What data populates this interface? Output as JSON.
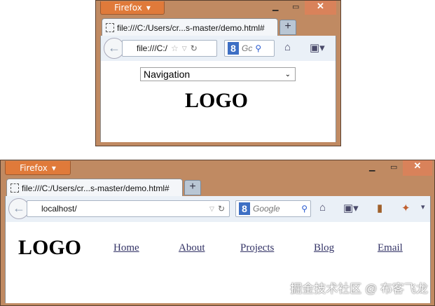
{
  "mobile_window": {
    "app_button": "Firefox",
    "tab_title": "file:///C:/Users/cr...s-master/demo.html#",
    "url": "file:///C:/",
    "search_placeholder": "Gc",
    "select_value": "Navigation",
    "logo": "LOGO"
  },
  "desktop_window": {
    "app_button": "Firefox",
    "tab_title": "file:///C:/Users/cr...s-master/demo.html#",
    "url": "localhost/",
    "search_placeholder": "Google",
    "logo": "LOGO",
    "nav": [
      "Home",
      "About",
      "Projects",
      "Blog",
      "Email"
    ]
  },
  "watermark": "掘金技术社区 @ 布客飞龙"
}
